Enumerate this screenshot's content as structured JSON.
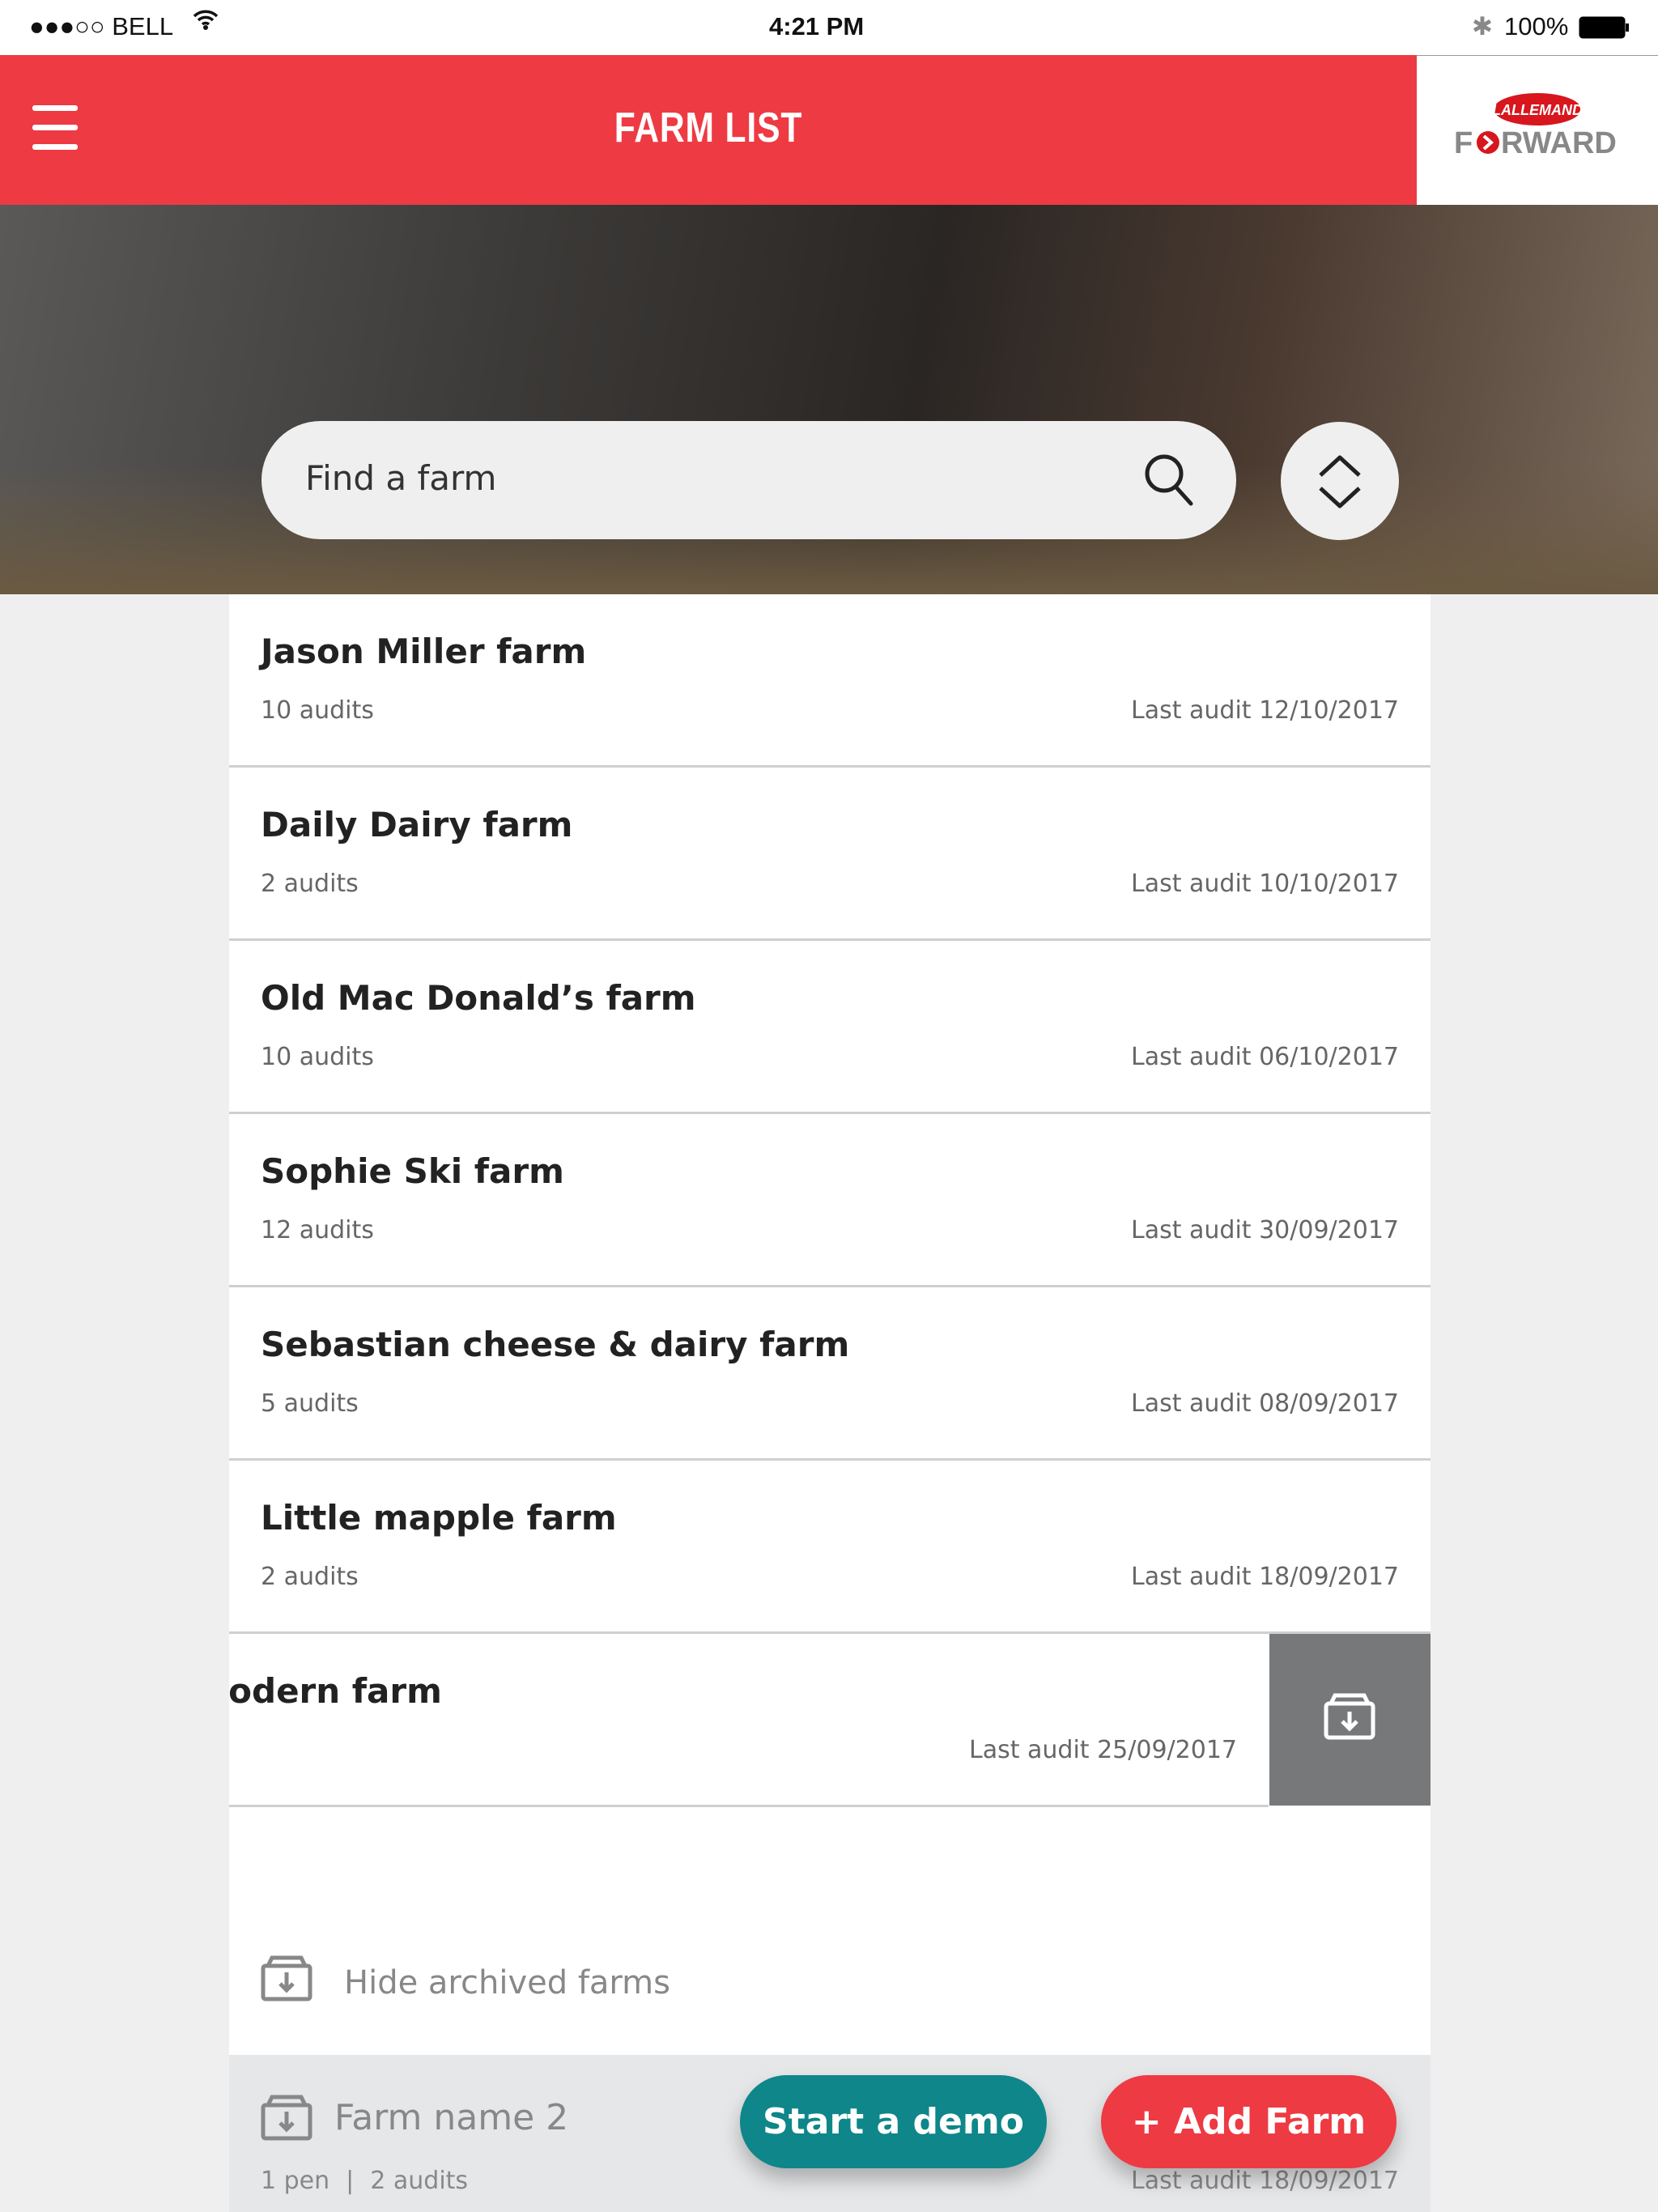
{
  "status_bar": {
    "carrier": "●●●○○ BELL",
    "time": "4:21 PM",
    "battery": "100%"
  },
  "header": {
    "title": "FARM LIST",
    "logo_top": "LALLEMAND",
    "logo_bottom": "FORWARD",
    "color": "#ee3a43"
  },
  "search": {
    "placeholder": "Find a farm"
  },
  "farms": [
    {
      "name": "Jason Miller farm",
      "audits": "10 audits",
      "last_audit": "Last audit 12/10/2017"
    },
    {
      "name": "Daily Dairy farm",
      "audits": "2 audits",
      "last_audit": "Last audit 10/10/2017"
    },
    {
      "name": "Old Mac Donald’s farm",
      "audits": "10 audits",
      "last_audit": "Last audit 06/10/2017"
    },
    {
      "name": "Sophie Ski farm",
      "audits": "12 audits",
      "last_audit": "Last audit 30/09/2017"
    },
    {
      "name": "Sebastian cheese & dairy farm",
      "audits": "5 audits",
      "last_audit": "Last audit 08/09/2017"
    },
    {
      "name": "Little mapple  farm",
      "audits": "2 audits",
      "last_audit": "Last audit 18/09/2017"
    },
    {
      "name": "Pam modern farm",
      "last_audit": "Last audit 25/09/2017"
    }
  ],
  "hide_archived": "Hide archived farms",
  "archived_farm": {
    "name": "Farm name 2",
    "pens": "1 pen",
    "audits": "2 audits",
    "last_audit": "Last audit 18/09/2017"
  },
  "buttons": {
    "demo": "Start a demo",
    "add": "+ Add Farm",
    "demo_color": "#0e868a",
    "add_color": "#ee3a43"
  }
}
